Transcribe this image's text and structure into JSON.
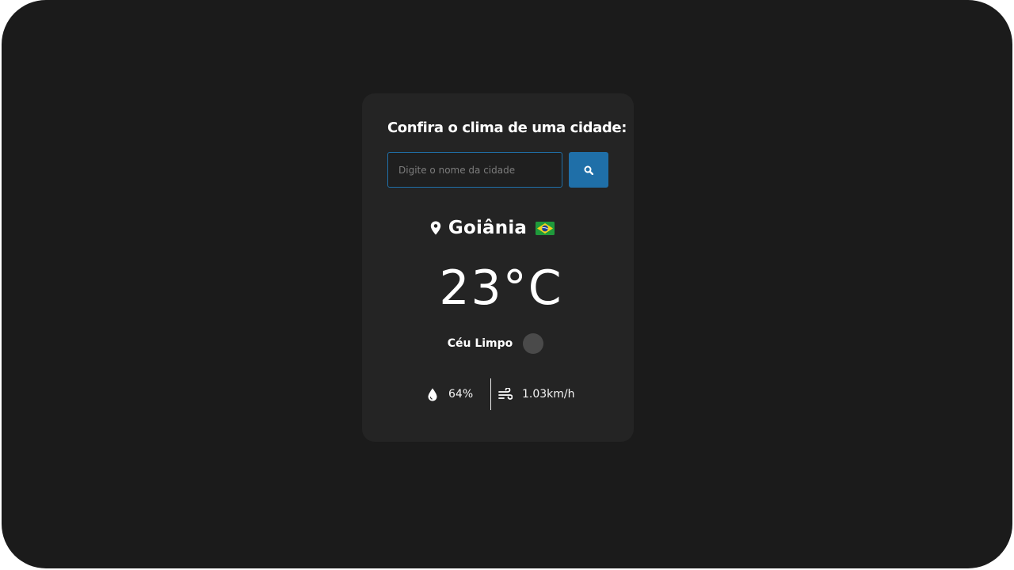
{
  "card": {
    "title": "Confira o clima de uma cidade:"
  },
  "search": {
    "placeholder": "Digite o nome da cidade",
    "value": "",
    "button_icon": "search-icon"
  },
  "location": {
    "icon": "location-pin-icon",
    "city": "Goiânia",
    "country_flag": "brazil-flag-icon"
  },
  "weather": {
    "temperature": "23",
    "unit": "°C",
    "description": "Céu Limpo",
    "description_icon": "weather-condition-icon"
  },
  "details": {
    "humidity": "64%",
    "humidity_icon": "water-drop-icon",
    "wind": "1.03km/h",
    "wind_icon": "wind-icon"
  },
  "colors": {
    "background": "#1b1b1b",
    "card": "#242424",
    "accent": "#1f6fa8",
    "text": "#ffffff"
  }
}
